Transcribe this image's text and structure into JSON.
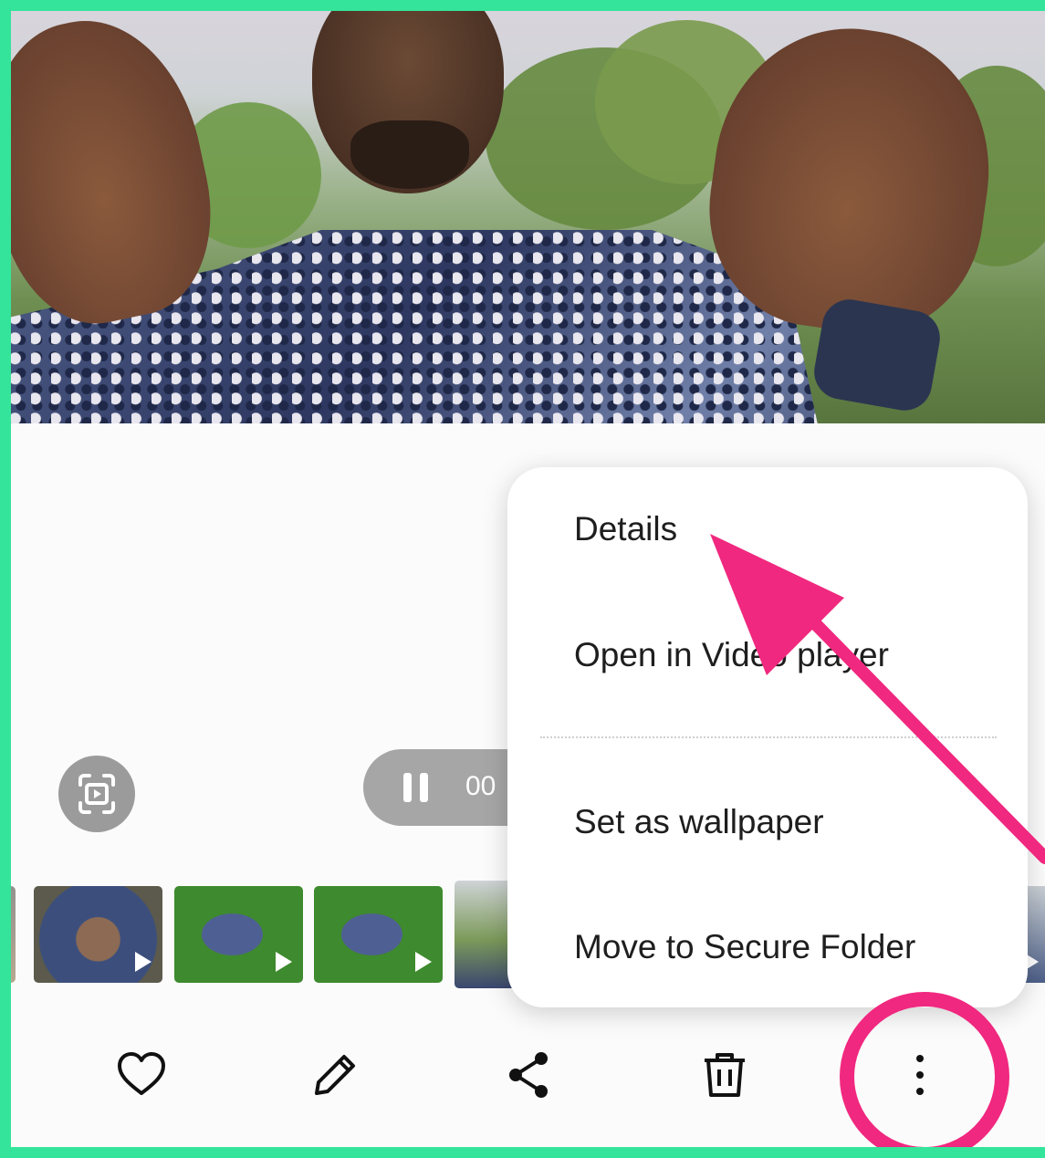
{
  "video": {
    "elapsed_time_partial": "00"
  },
  "menu": {
    "items": [
      {
        "label": "Details"
      },
      {
        "label": "Open in Video player"
      },
      {
        "label": "Set as wallpaper"
      },
      {
        "label": "Move to Secure Folder"
      }
    ]
  },
  "filmstrip": {
    "thumbnails": [
      {
        "kind": "video",
        "subject": "hands-holding-stones"
      },
      {
        "kind": "video",
        "subject": "man-lying-on-grass"
      },
      {
        "kind": "video",
        "subject": "man-lying-on-grass"
      },
      {
        "kind": "video",
        "subject": "man-raising-hands",
        "current": true
      }
    ]
  },
  "toolbar": {
    "buttons": [
      {
        "icon": "heart-icon",
        "action": "favorite"
      },
      {
        "icon": "pencil-icon",
        "action": "edit"
      },
      {
        "icon": "share-icon",
        "action": "share"
      },
      {
        "icon": "trash-icon",
        "action": "delete"
      },
      {
        "icon": "more-vertical-icon",
        "action": "more options"
      }
    ]
  },
  "annotations": {
    "arrow_color": "#f0287f",
    "circle_color": "#f0287f",
    "frame_color": "#34e49a"
  }
}
